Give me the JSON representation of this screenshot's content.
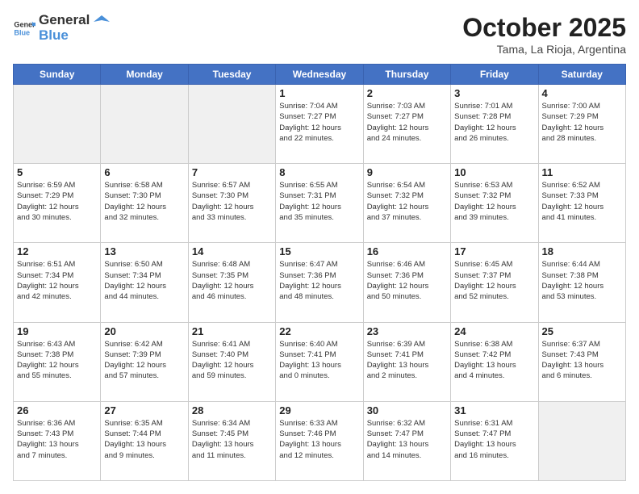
{
  "header": {
    "logo": {
      "general": "General",
      "blue": "Blue"
    },
    "title": "October 2025",
    "location": "Tama, La Rioja, Argentina"
  },
  "calendar": {
    "days": [
      "Sunday",
      "Monday",
      "Tuesday",
      "Wednesday",
      "Thursday",
      "Friday",
      "Saturday"
    ],
    "rows": [
      [
        {
          "day": "",
          "info": ""
        },
        {
          "day": "",
          "info": ""
        },
        {
          "day": "",
          "info": ""
        },
        {
          "day": "1",
          "info": "Sunrise: 7:04 AM\nSunset: 7:27 PM\nDaylight: 12 hours\nand 22 minutes."
        },
        {
          "day": "2",
          "info": "Sunrise: 7:03 AM\nSunset: 7:27 PM\nDaylight: 12 hours\nand 24 minutes."
        },
        {
          "day": "3",
          "info": "Sunrise: 7:01 AM\nSunset: 7:28 PM\nDaylight: 12 hours\nand 26 minutes."
        },
        {
          "day": "4",
          "info": "Sunrise: 7:00 AM\nSunset: 7:29 PM\nDaylight: 12 hours\nand 28 minutes."
        }
      ],
      [
        {
          "day": "5",
          "info": "Sunrise: 6:59 AM\nSunset: 7:29 PM\nDaylight: 12 hours\nand 30 minutes."
        },
        {
          "day": "6",
          "info": "Sunrise: 6:58 AM\nSunset: 7:30 PM\nDaylight: 12 hours\nand 32 minutes."
        },
        {
          "day": "7",
          "info": "Sunrise: 6:57 AM\nSunset: 7:30 PM\nDaylight: 12 hours\nand 33 minutes."
        },
        {
          "day": "8",
          "info": "Sunrise: 6:55 AM\nSunset: 7:31 PM\nDaylight: 12 hours\nand 35 minutes."
        },
        {
          "day": "9",
          "info": "Sunrise: 6:54 AM\nSunset: 7:32 PM\nDaylight: 12 hours\nand 37 minutes."
        },
        {
          "day": "10",
          "info": "Sunrise: 6:53 AM\nSunset: 7:32 PM\nDaylight: 12 hours\nand 39 minutes."
        },
        {
          "day": "11",
          "info": "Sunrise: 6:52 AM\nSunset: 7:33 PM\nDaylight: 12 hours\nand 41 minutes."
        }
      ],
      [
        {
          "day": "12",
          "info": "Sunrise: 6:51 AM\nSunset: 7:34 PM\nDaylight: 12 hours\nand 42 minutes."
        },
        {
          "day": "13",
          "info": "Sunrise: 6:50 AM\nSunset: 7:34 PM\nDaylight: 12 hours\nand 44 minutes."
        },
        {
          "day": "14",
          "info": "Sunrise: 6:48 AM\nSunset: 7:35 PM\nDaylight: 12 hours\nand 46 minutes."
        },
        {
          "day": "15",
          "info": "Sunrise: 6:47 AM\nSunset: 7:36 PM\nDaylight: 12 hours\nand 48 minutes."
        },
        {
          "day": "16",
          "info": "Sunrise: 6:46 AM\nSunset: 7:36 PM\nDaylight: 12 hours\nand 50 minutes."
        },
        {
          "day": "17",
          "info": "Sunrise: 6:45 AM\nSunset: 7:37 PM\nDaylight: 12 hours\nand 52 minutes."
        },
        {
          "day": "18",
          "info": "Sunrise: 6:44 AM\nSunset: 7:38 PM\nDaylight: 12 hours\nand 53 minutes."
        }
      ],
      [
        {
          "day": "19",
          "info": "Sunrise: 6:43 AM\nSunset: 7:38 PM\nDaylight: 12 hours\nand 55 minutes."
        },
        {
          "day": "20",
          "info": "Sunrise: 6:42 AM\nSunset: 7:39 PM\nDaylight: 12 hours\nand 57 minutes."
        },
        {
          "day": "21",
          "info": "Sunrise: 6:41 AM\nSunset: 7:40 PM\nDaylight: 12 hours\nand 59 minutes."
        },
        {
          "day": "22",
          "info": "Sunrise: 6:40 AM\nSunset: 7:41 PM\nDaylight: 13 hours\nand 0 minutes."
        },
        {
          "day": "23",
          "info": "Sunrise: 6:39 AM\nSunset: 7:41 PM\nDaylight: 13 hours\nand 2 minutes."
        },
        {
          "day": "24",
          "info": "Sunrise: 6:38 AM\nSunset: 7:42 PM\nDaylight: 13 hours\nand 4 minutes."
        },
        {
          "day": "25",
          "info": "Sunrise: 6:37 AM\nSunset: 7:43 PM\nDaylight: 13 hours\nand 6 minutes."
        }
      ],
      [
        {
          "day": "26",
          "info": "Sunrise: 6:36 AM\nSunset: 7:43 PM\nDaylight: 13 hours\nand 7 minutes."
        },
        {
          "day": "27",
          "info": "Sunrise: 6:35 AM\nSunset: 7:44 PM\nDaylight: 13 hours\nand 9 minutes."
        },
        {
          "day": "28",
          "info": "Sunrise: 6:34 AM\nSunset: 7:45 PM\nDaylight: 13 hours\nand 11 minutes."
        },
        {
          "day": "29",
          "info": "Sunrise: 6:33 AM\nSunset: 7:46 PM\nDaylight: 13 hours\nand 12 minutes."
        },
        {
          "day": "30",
          "info": "Sunrise: 6:32 AM\nSunset: 7:47 PM\nDaylight: 13 hours\nand 14 minutes."
        },
        {
          "day": "31",
          "info": "Sunrise: 6:31 AM\nSunset: 7:47 PM\nDaylight: 13 hours\nand 16 minutes."
        },
        {
          "day": "",
          "info": ""
        }
      ]
    ]
  }
}
